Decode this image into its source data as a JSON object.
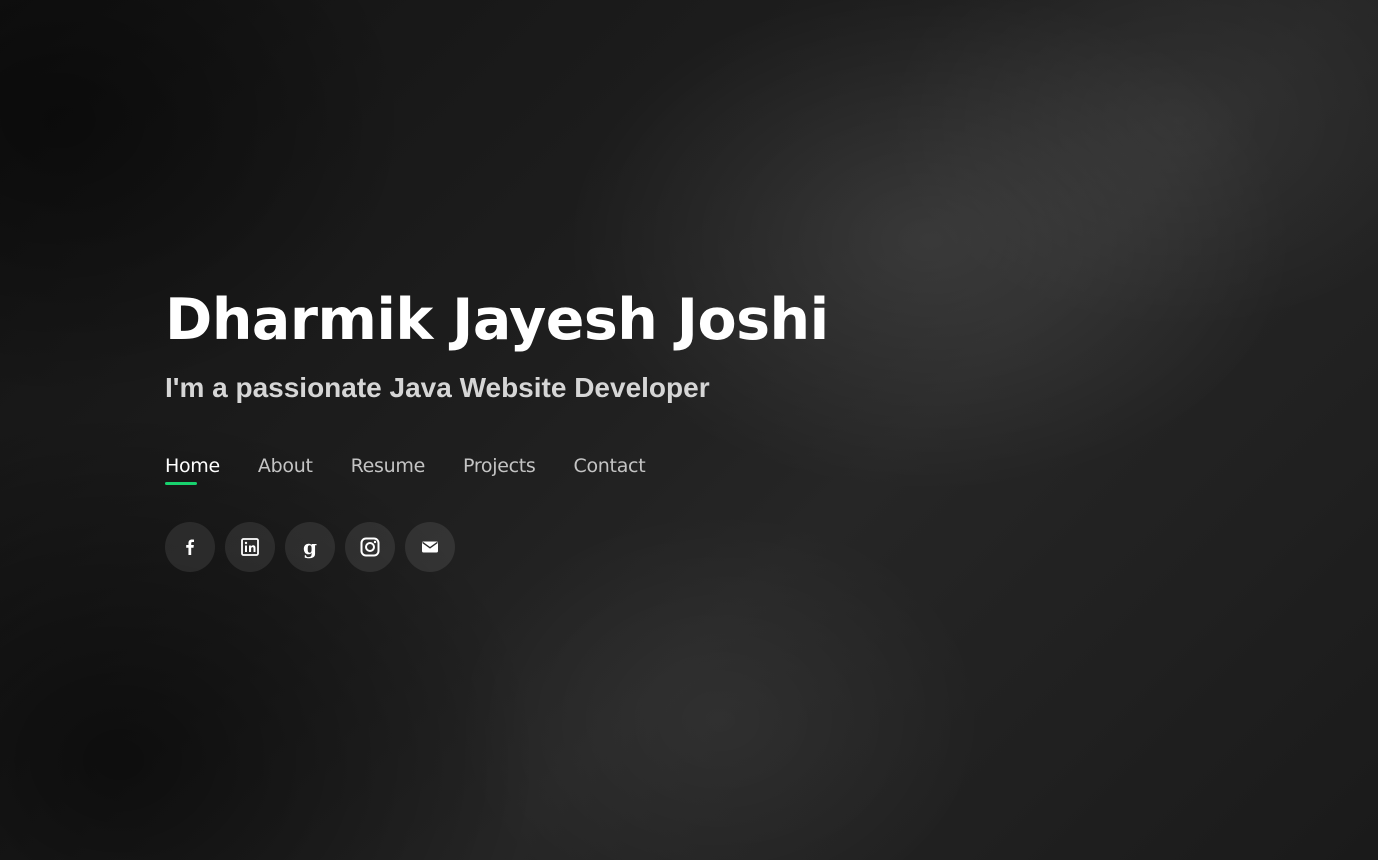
{
  "hero": {
    "name": "Dharmik Jayesh Joshi",
    "tagline": "I'm a passionate Java Website Developer"
  },
  "nav": {
    "items": [
      {
        "label": "Home",
        "active": true
      },
      {
        "label": "About",
        "active": false
      },
      {
        "label": "Resume",
        "active": false
      },
      {
        "label": "Projects",
        "active": false
      },
      {
        "label": "Contact",
        "active": false
      }
    ]
  },
  "social": {
    "icons": [
      "facebook-icon",
      "linkedin-icon",
      "goodreads-icon",
      "instagram-icon",
      "email-icon"
    ]
  },
  "colors": {
    "accent": "#18d26e",
    "background": "#1b1b1b",
    "text": "#ffffff",
    "muted_text": "#c4c4c4"
  }
}
